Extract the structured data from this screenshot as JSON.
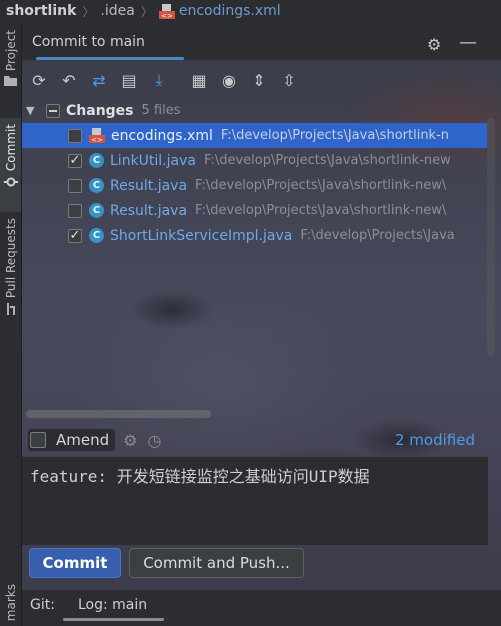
{
  "breadcrumb": {
    "project": "shortlink",
    "folder": ".idea",
    "file": "encodings.xml"
  },
  "left_stripe": {
    "project_tab": "Project",
    "commit_tab": "Commit",
    "pull_requests_tab": "Pull Requests",
    "bookmarks_tab": "marks"
  },
  "tool_window": {
    "title": "Commit to main"
  },
  "toolbar": {
    "icons": [
      "refresh-icon",
      "rollback-icon",
      "diff-icon",
      "shelve-icon",
      "download-icon",
      "group-by-icon",
      "eye-icon",
      "expand-all-icon",
      "collapse-all-icon"
    ]
  },
  "changes": {
    "label": "Changes",
    "count": "5 files",
    "files": [
      {
        "name": "encodings.xml",
        "path": "F:\\develop\\Projects\\Java\\shortlink-n",
        "checked": false,
        "type": "xml",
        "selected": true
      },
      {
        "name": "LinkUtil.java",
        "path": "F:\\develop\\Projects\\Java\\shortlink-new",
        "checked": true,
        "type": "java",
        "selected": false
      },
      {
        "name": "Result.java",
        "path": "F:\\develop\\Projects\\Java\\shortlink-new\\",
        "checked": false,
        "type": "java",
        "selected": false
      },
      {
        "name": "Result.java",
        "path": "F:\\develop\\Projects\\Java\\shortlink-new\\",
        "checked": false,
        "type": "java",
        "selected": false
      },
      {
        "name": "ShortLinkServiceImpl.java",
        "path": "F:\\develop\\Projects\\Java",
        "checked": true,
        "type": "java",
        "selected": false
      }
    ]
  },
  "amend": {
    "label": "Amend",
    "checked": false,
    "modified": "2 modified"
  },
  "commit_message": "feature: 开发短链接监控之基础访问UIP数据",
  "buttons": {
    "commit": "Commit",
    "commit_and_push": "Commit and Push..."
  },
  "bottom": {
    "git_label": "Git:",
    "log_tab": "Log: main"
  },
  "colors": {
    "accent": "#4e9be8",
    "selection": "#2f65ca",
    "primary_button": "#375fad"
  }
}
